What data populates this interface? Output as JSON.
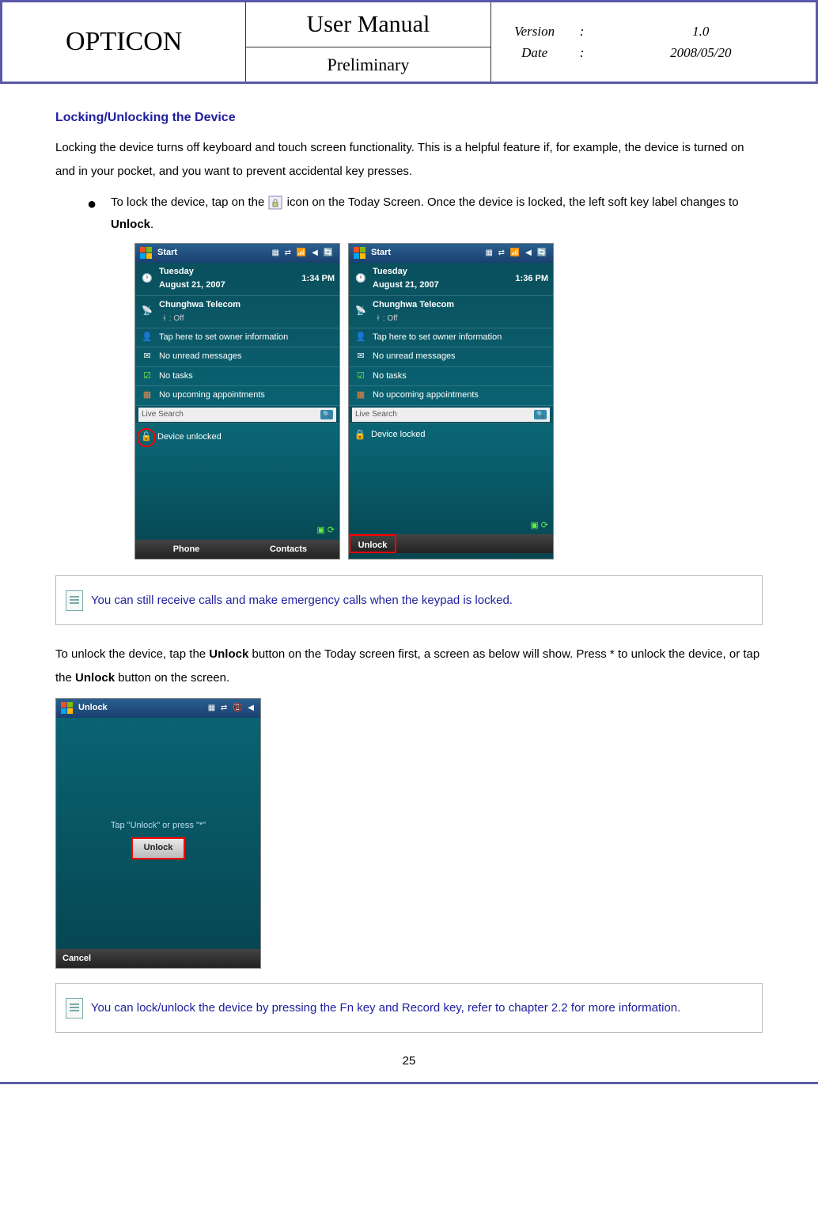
{
  "header": {
    "brand": "OPTICON",
    "title": "User Manual",
    "subtitle": "Preliminary",
    "version_label": "Version",
    "version_value": "1.0",
    "date_label": "Date",
    "date_value": "2008/05/20"
  },
  "section_title": "Locking/Unlocking the Device",
  "para1": "Locking the device turns off keyboard and touch screen functionality. This is a helpful feature if, for example, the device is turned on and in your pocket, and you want to prevent accidental key presses.",
  "bullet1_a": "To lock the device, tap on the ",
  "bullet1_b": " icon on the Today Screen. Once the device is locked, the left soft key label changes to ",
  "bullet1_bold": "Unlock",
  "bullet1_end": ".",
  "screen_left": {
    "title": "Start",
    "day": "Tuesday",
    "date": "August 21, 2007",
    "time": "1:34 PM",
    "carrier": "Chunghwa Telecom",
    "bt_status": ": Off",
    "owner": "Tap here to set owner information",
    "messages": "No unread messages",
    "tasks": "No tasks",
    "appts": "No upcoming appointments",
    "search_ph": "Live Search",
    "lock_status": "Device unlocked",
    "left_soft": "Phone",
    "right_soft": "Contacts"
  },
  "screen_right": {
    "title": "Start",
    "day": "Tuesday",
    "date": "August 21, 2007",
    "time": "1:36 PM",
    "carrier": "Chunghwa Telecom",
    "bt_status": ": Off",
    "owner": "Tap here to set owner information",
    "messages": "No unread messages",
    "tasks": "No tasks",
    "appts": "No upcoming appointments",
    "search_ph": "Live Search",
    "lock_status": "Device locked",
    "left_soft": "Unlock",
    "right_soft": ""
  },
  "note1": "You can still receive calls and make emergency calls when the keypad is locked.",
  "para2_a": "To unlock the device, tap the ",
  "para2_bold1": "Unlock",
  "para2_b": " button on the Today screen first, a screen as below will show. Press * to unlock the device, or tap the ",
  "para2_bold2": "Unlock",
  "para2_c": " button on the screen.",
  "unlock_screen": {
    "title": "Unlock",
    "hint": "Tap \"Unlock\" or press \"*\"",
    "button": "Unlock",
    "cancel": "Cancel"
  },
  "note2": "You can lock/unlock the device by pressing the Fn key and Record key, refer to chapter 2.2 for more information.",
  "page_num": "25"
}
